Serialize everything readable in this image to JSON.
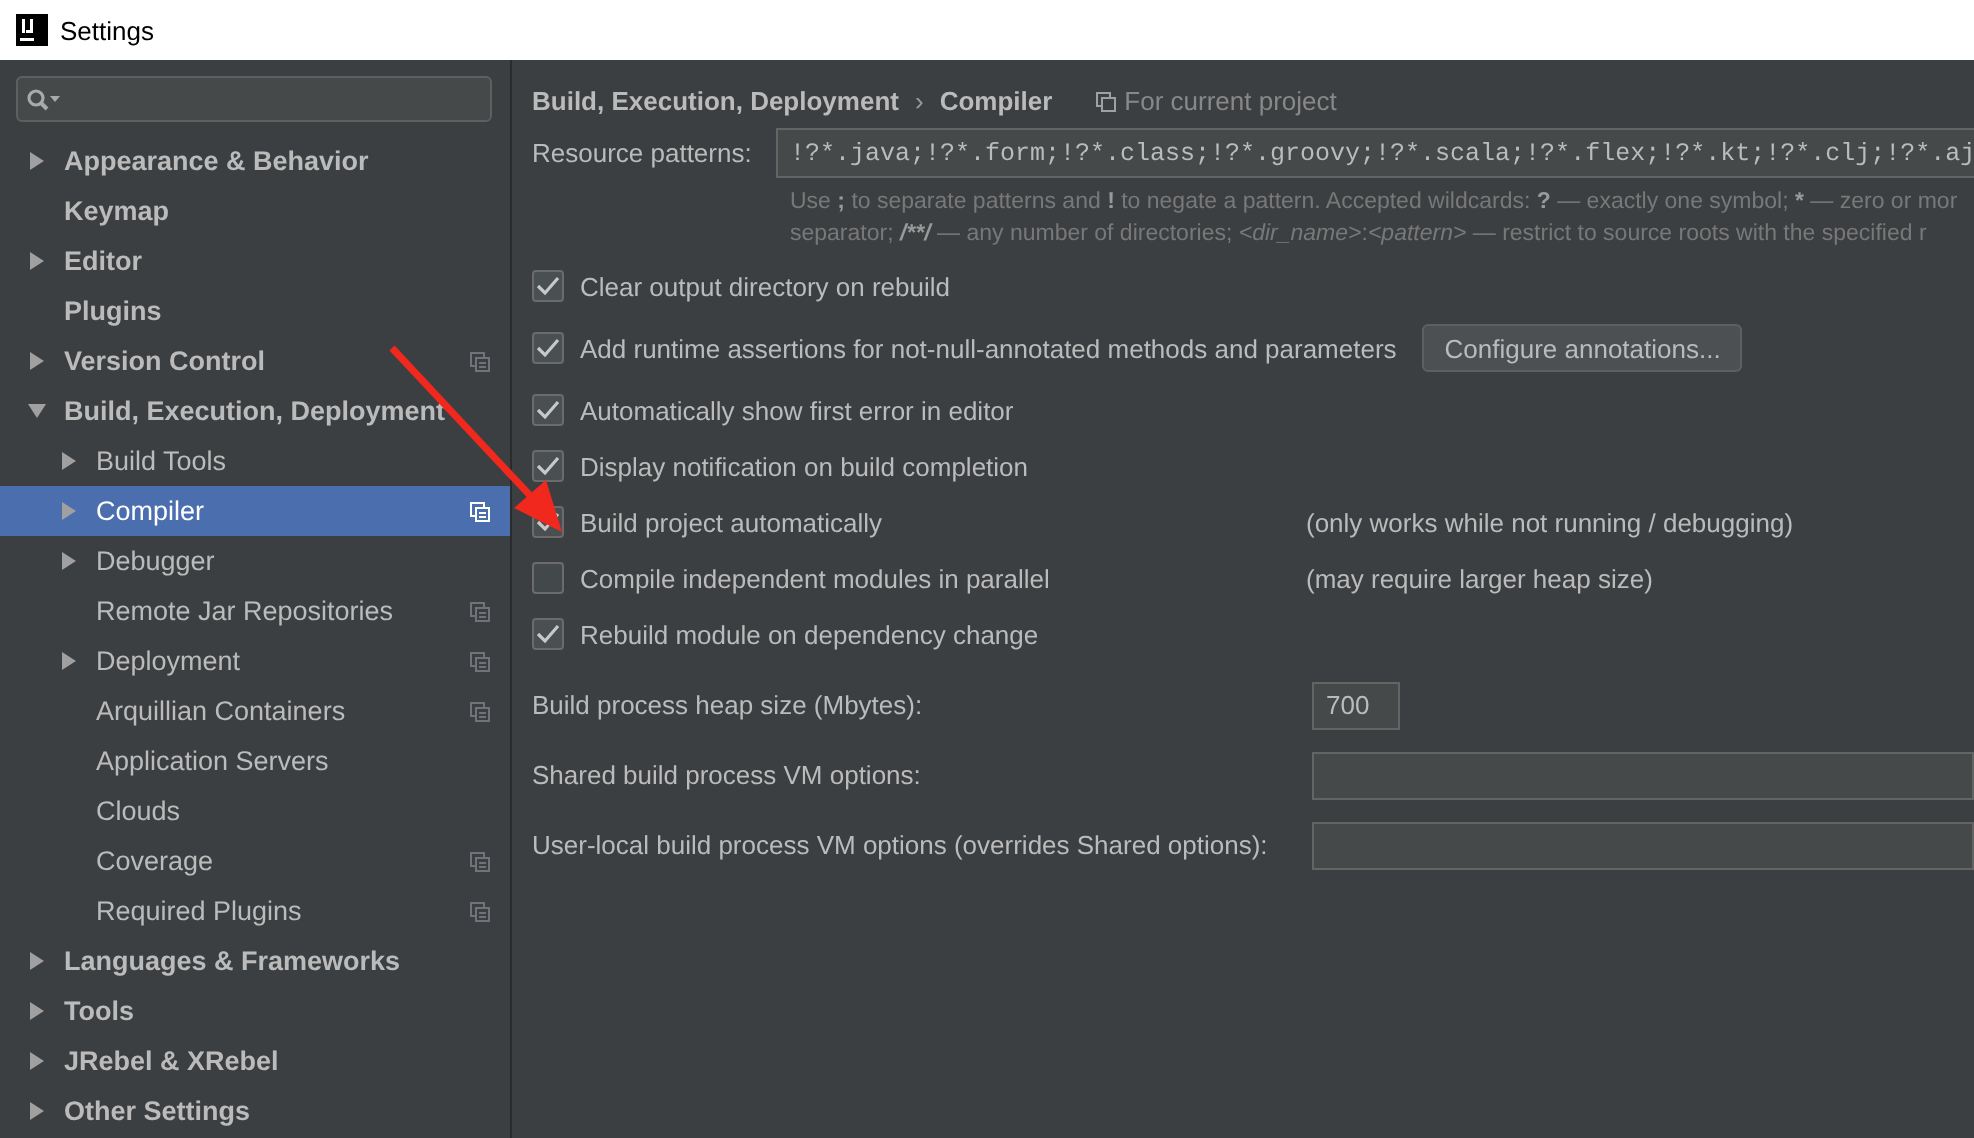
{
  "window": {
    "title": "Settings"
  },
  "sidebar": {
    "items": [
      {
        "label": "Appearance & Behavior",
        "expanded": false,
        "selected": false,
        "project_scope": false
      },
      {
        "label": "Keymap",
        "selected": false,
        "project_scope": false
      },
      {
        "label": "Editor",
        "expanded": false,
        "selected": false,
        "project_scope": false
      },
      {
        "label": "Plugins",
        "selected": false,
        "project_scope": false
      },
      {
        "label": "Version Control",
        "expanded": false,
        "selected": false,
        "project_scope": true
      },
      {
        "label": "Build, Execution, Deployment",
        "expanded": true,
        "selected": false,
        "project_scope": false,
        "children": [
          {
            "label": "Build Tools",
            "expanded": false,
            "selected": false,
            "project_scope": false
          },
          {
            "label": "Compiler",
            "expanded": false,
            "selected": true,
            "project_scope": true
          },
          {
            "label": "Debugger",
            "expanded": false,
            "selected": false,
            "project_scope": false
          },
          {
            "label": "Remote Jar Repositories",
            "selected": false,
            "project_scope": true
          },
          {
            "label": "Deployment",
            "expanded": false,
            "selected": false,
            "project_scope": true
          },
          {
            "label": "Arquillian Containers",
            "selected": false,
            "project_scope": true
          },
          {
            "label": "Application Servers",
            "selected": false,
            "project_scope": false
          },
          {
            "label": "Clouds",
            "selected": false,
            "project_scope": false
          },
          {
            "label": "Coverage",
            "selected": false,
            "project_scope": true
          },
          {
            "label": "Required Plugins",
            "selected": false,
            "project_scope": true
          }
        ]
      },
      {
        "label": "Languages & Frameworks",
        "expanded": false,
        "selected": false,
        "project_scope": false
      },
      {
        "label": "Tools",
        "expanded": false,
        "selected": false,
        "project_scope": false
      },
      {
        "label": "JRebel & XRebel",
        "expanded": false,
        "selected": false,
        "project_scope": false
      },
      {
        "label": "Other Settings",
        "expanded": false,
        "selected": false,
        "project_scope": false
      }
    ]
  },
  "breadcrumb": {
    "parent": "Build, Execution, Deployment",
    "separator": "›",
    "current": "Compiler",
    "scope_note": "For current project"
  },
  "resource_patterns": {
    "label": "Resource patterns:",
    "value": "!?*.java;!?*.form;!?*.class;!?*.groovy;!?*.scala;!?*.flex;!?*.kt;!?*.clj;!?*.aj",
    "hint_lines": [
      [
        {
          "text": "Use ",
          "kind": "plain"
        },
        {
          "text": ";",
          "kind": "symbol"
        },
        {
          "text": " to separate patterns and ",
          "kind": "plain"
        },
        {
          "text": "!",
          "kind": "symbol"
        },
        {
          "text": " to negate a pattern. Accepted wildcards: ",
          "kind": "plain"
        },
        {
          "text": "?",
          "kind": "symbol"
        },
        {
          "text": " — exactly one symbol; ",
          "kind": "plain"
        },
        {
          "text": "*",
          "kind": "symbol"
        },
        {
          "text": " — zero or mor",
          "kind": "plain"
        }
      ],
      [
        {
          "text": "separator; ",
          "kind": "plain"
        },
        {
          "text": "/**/",
          "kind": "pattern"
        },
        {
          "text": " — any number of directories; ",
          "kind": "plain"
        },
        {
          "text": "<dir_name>",
          "kind": "placeholder"
        },
        {
          "text": ":",
          "kind": "plain"
        },
        {
          "text": "<pattern>",
          "kind": "placeholder"
        },
        {
          "text": " — restrict to source roots with the specified r",
          "kind": "plain"
        }
      ]
    ]
  },
  "options": [
    {
      "label": "Clear output directory on rebuild",
      "checked": true
    },
    {
      "label": "Add runtime assertions for not-null-annotated methods and parameters",
      "checked": true,
      "button": "Configure annotations..."
    },
    {
      "label": "Automatically show first error in editor",
      "checked": true
    },
    {
      "label": "Display notification on build completion",
      "checked": true
    },
    {
      "label": "Build project automatically",
      "checked": true,
      "note": "(only works while not running / debugging)"
    },
    {
      "label": "Compile independent modules in parallel",
      "checked": false,
      "note": "(may require larger heap size)"
    },
    {
      "label": "Rebuild module on dependency change",
      "checked": true
    }
  ],
  "fields": [
    {
      "label": "Build process heap size (Mbytes):",
      "value": "700",
      "kind": "short"
    },
    {
      "label": "Shared build process VM options:",
      "kind": "wide"
    },
    {
      "label": "User-local build process VM options (overrides Shared options):",
      "kind": "wide"
    }
  ]
}
